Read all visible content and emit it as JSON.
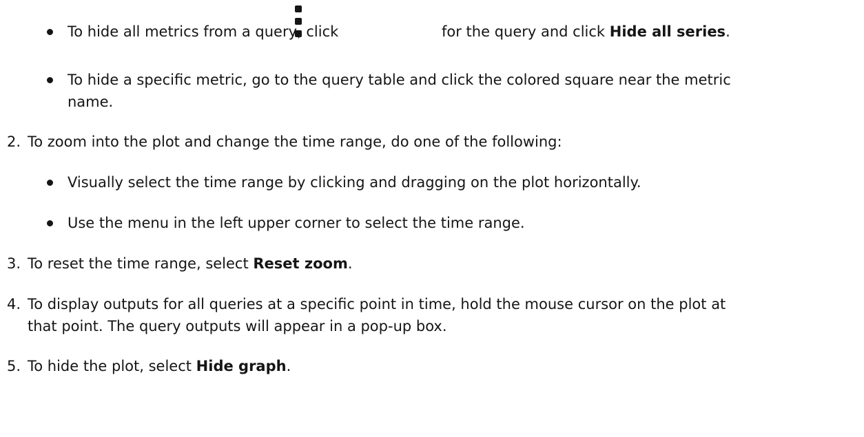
{
  "bullets_top": [
    {
      "before": "To hide all metrics from a query, click",
      "icon": "kebab-menu-icon",
      "after": "for the query and click ",
      "bold": "Hide all series",
      "end": "."
    },
    {
      "line1": "To hide a specific metric, go to the query table and click the colored square near the metric",
      "line2": "name."
    }
  ],
  "steps": [
    {
      "number": "2.",
      "text": "To zoom into the plot and change the time range, do one of the following:",
      "bullets": [
        "Visually select the time range by clicking and dragging on the plot horizontally.",
        "Use the menu in the left upper corner to select the time range."
      ]
    },
    {
      "number": "3.",
      "text": "To reset the time range, select ",
      "bold": "Reset zoom",
      "end": "."
    },
    {
      "number": "4.",
      "line1": "To display outputs for all queries at a specific point in time, hold the mouse cursor on the plot at",
      "line2": "that point. The query outputs will appear in a pop-up box."
    },
    {
      "number": "5.",
      "text": "To hide the plot, select ",
      "bold": "Hide graph",
      "end": "."
    }
  ]
}
